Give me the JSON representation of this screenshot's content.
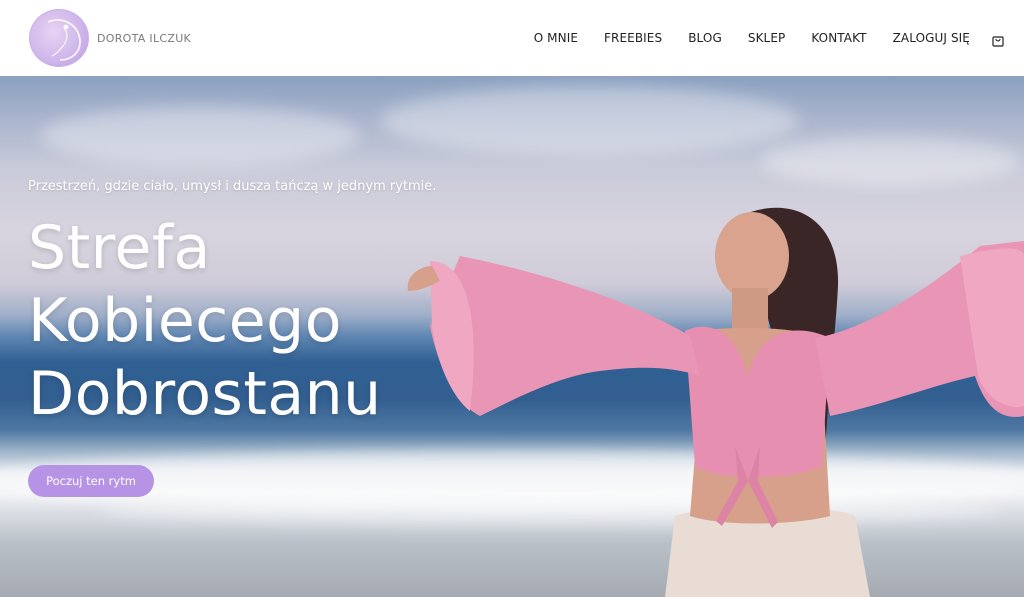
{
  "brand": {
    "name": "DOROTA ILCZUK",
    "logo_icon": "logo-emblem-icon",
    "accent": "#b793e6"
  },
  "nav": {
    "items": [
      "O MNIE",
      "FREEBIES",
      "BLOG",
      "SKLEP",
      "KONTAKT",
      "ZALOGUJ SIĘ"
    ],
    "cart_icon": "shopping-bag-icon"
  },
  "hero": {
    "tagline": "Przestrzeń, gdzie ciało, umysł i dusza tańczą w jednym rytmie.",
    "headline_lines": [
      "Strefa",
      "Kobiecego",
      "Dobrostanu"
    ],
    "cta_label": "Poczuj ten rytm",
    "cta_color": "#b793e6",
    "blouse_color": "#e68fb0"
  }
}
